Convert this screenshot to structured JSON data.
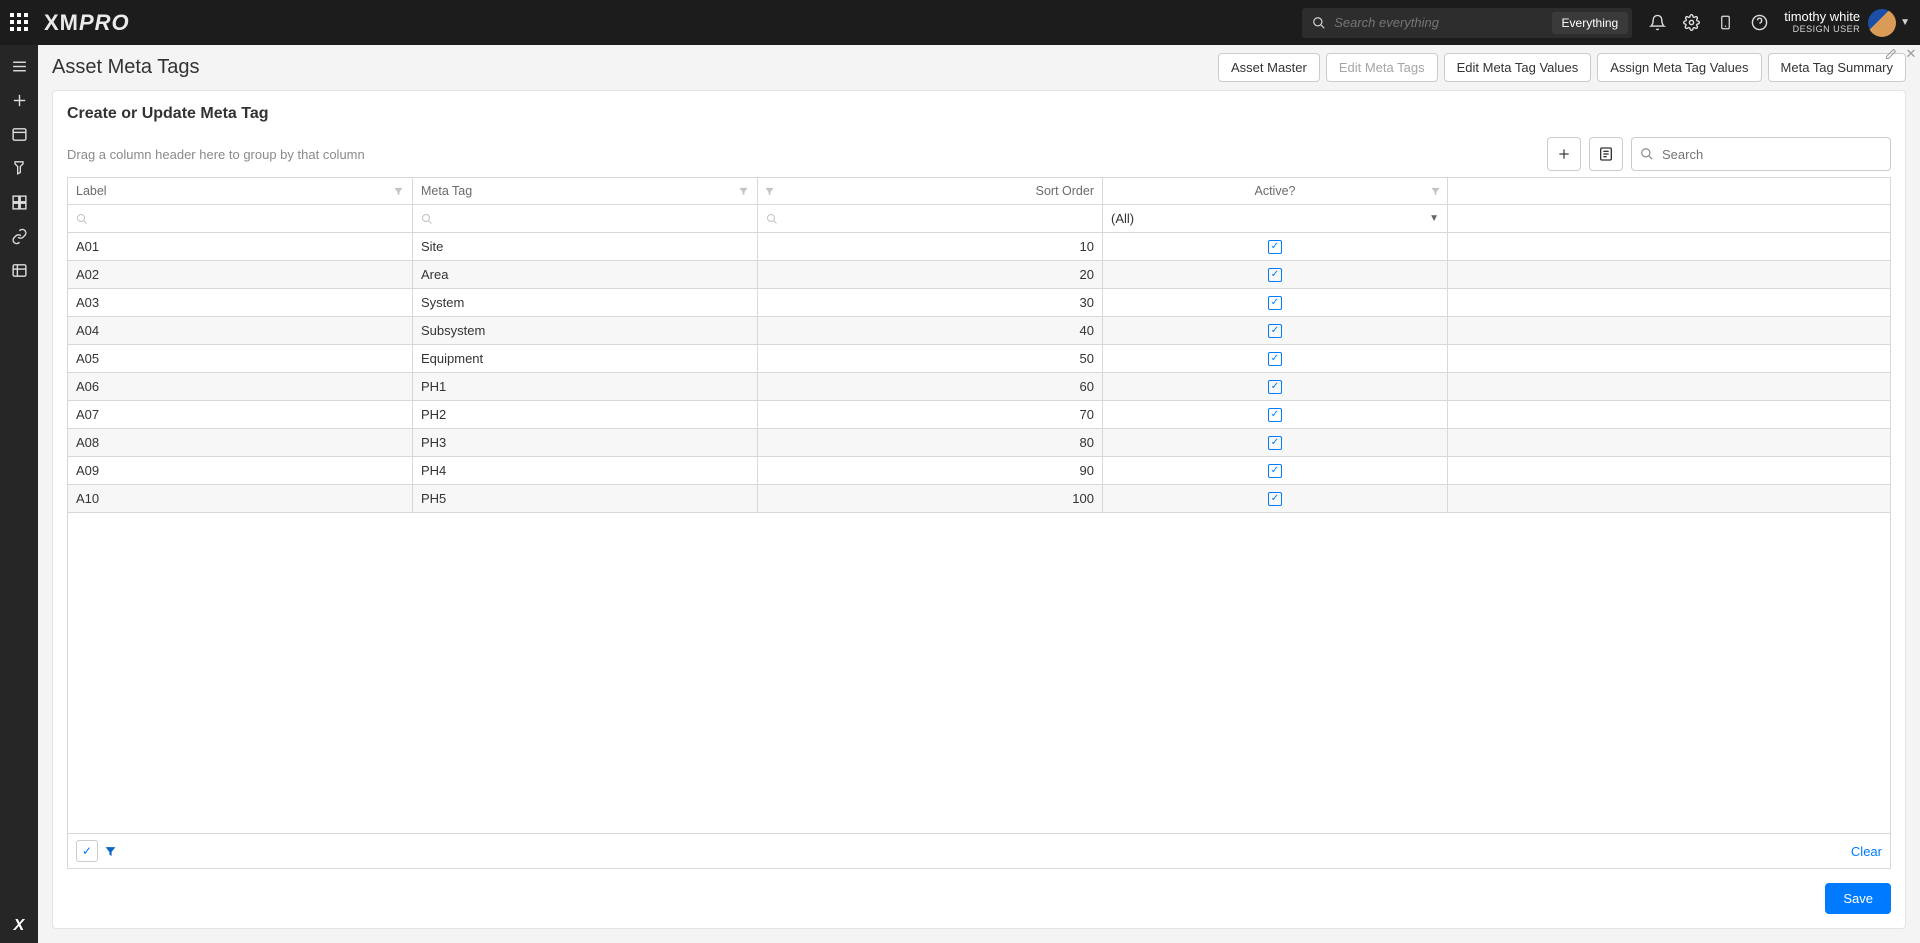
{
  "header": {
    "search_placeholder": "Search everything",
    "search_scope": "Everything",
    "user_name": "timothy white",
    "user_role": "DESIGN USER"
  },
  "page": {
    "title": "Asset Meta Tags",
    "tabs": {
      "asset_master": "Asset Master",
      "edit_meta_tags": "Edit Meta Tags",
      "edit_values": "Edit Meta Tag Values",
      "assign_values": "Assign Meta Tag Values",
      "summary": "Meta Tag Summary"
    }
  },
  "panel": {
    "heading": "Create or Update Meta Tag",
    "group_hint": "Drag a column header here to group by that column",
    "search_placeholder": "Search"
  },
  "columns": {
    "label": "Label",
    "meta_tag": "Meta Tag",
    "sort_order": "Sort Order",
    "active": "Active?"
  },
  "filter_row": {
    "active_all": "(All)"
  },
  "rows": [
    {
      "label": "A01",
      "meta": "Site",
      "sort": "10",
      "active": true
    },
    {
      "label": "A02",
      "meta": "Area",
      "sort": "20",
      "active": true
    },
    {
      "label": "A03",
      "meta": "System",
      "sort": "30",
      "active": true
    },
    {
      "label": "A04",
      "meta": "Subsystem",
      "sort": "40",
      "active": true
    },
    {
      "label": "A05",
      "meta": "Equipment",
      "sort": "50",
      "active": true
    },
    {
      "label": "A06",
      "meta": "PH1",
      "sort": "60",
      "active": true
    },
    {
      "label": "A07",
      "meta": "PH2",
      "sort": "70",
      "active": true
    },
    {
      "label": "A08",
      "meta": "PH3",
      "sort": "80",
      "active": true
    },
    {
      "label": "A09",
      "meta": "PH4",
      "sort": "90",
      "active": true
    },
    {
      "label": "A10",
      "meta": "PH5",
      "sort": "100",
      "active": true
    }
  ],
  "footer": {
    "clear": "Clear",
    "save": "Save"
  }
}
